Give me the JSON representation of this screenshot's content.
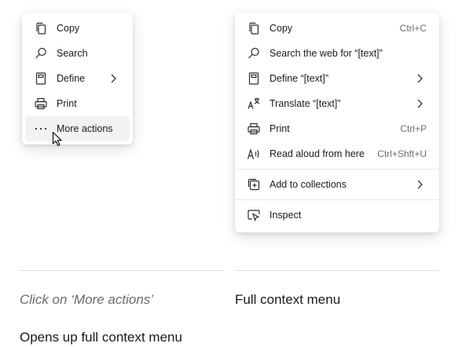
{
  "small_menu": {
    "items": [
      {
        "label": "Copy",
        "icon": "copy-icon"
      },
      {
        "label": "Search",
        "icon": "search-icon"
      },
      {
        "label": "Define",
        "icon": "book-icon",
        "submenu": true
      },
      {
        "label": "Print",
        "icon": "printer-icon"
      },
      {
        "label": "More actions",
        "icon": "more-dots-icon",
        "hover": true
      }
    ]
  },
  "full_menu": {
    "items": [
      {
        "label": "Copy",
        "icon": "copy-icon",
        "shortcut": "Ctrl+C"
      },
      {
        "label": "Search the web for “[text]”",
        "icon": "search-icon"
      },
      {
        "label": "Define “[text]”",
        "icon": "book-icon",
        "submenu": true
      },
      {
        "label": "Translate “[text]”",
        "icon": "translate-icon",
        "submenu": true
      },
      {
        "label": "Print",
        "icon": "printer-icon",
        "shortcut": "Ctrl+P"
      },
      {
        "label": "Read aloud from here",
        "icon": "read-aloud-icon",
        "shortcut": "Ctrl+Shft+U"
      },
      {
        "label": "Add to collections",
        "icon": "collections-icon",
        "submenu": true
      },
      {
        "label": "Inspect",
        "icon": "inspect-icon"
      }
    ]
  },
  "captions": {
    "left": "Click on ‘More actions’",
    "right": "Full context menu",
    "left_sub": "Opens up full context menu"
  }
}
